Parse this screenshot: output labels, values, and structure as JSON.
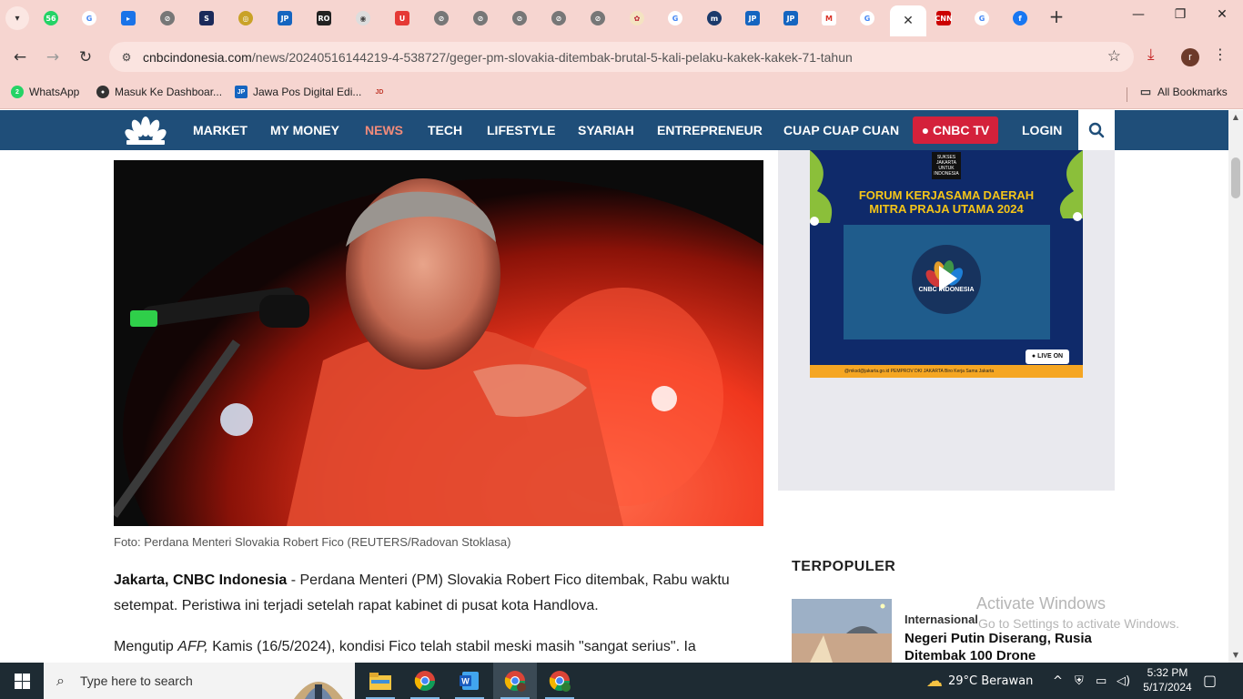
{
  "browser": {
    "active_tab_close": "✕",
    "new_tab": "+",
    "window_controls": {
      "minimize": "—",
      "maximize": "❐",
      "close": "✕"
    },
    "url_domain": "cnbcindonesia.com",
    "url_path": "/news/20240516144219-4-538727/geger-pm-slovakia-ditembak-brutal-5-kali-pelaku-kakek-kakek-71-tahun",
    "profile_initial": "r",
    "bookmarks": [
      {
        "label": "WhatsApp"
      },
      {
        "label": "Masuk Ke Dashboar..."
      },
      {
        "label": "Jawa Pos Digital Edi..."
      }
    ],
    "all_bookmarks": "All Bookmarks"
  },
  "site": {
    "nav": [
      {
        "label": "MARKET"
      },
      {
        "label": "MY MONEY"
      },
      {
        "label": "NEWS"
      },
      {
        "label": "TECH"
      },
      {
        "label": "LIFESTYLE"
      },
      {
        "label": "SYARIAH"
      },
      {
        "label": "ENTREPRENEUR"
      },
      {
        "label": "CUAP CUAP CUAN"
      }
    ],
    "cnbc_tv": "● CNBC TV",
    "login": "LOGIN"
  },
  "article": {
    "caption": "Foto: Perdana Menteri Slovakia Robert Fico (REUTERS/Radovan Stoklasa)",
    "lead_bold": "Jakarta, CNBC Indonesia",
    "lead_text": " - Perdana Menteri (PM) Slovakia Robert Fico ditembak, Rabu waktu setempat. Peristiwa ini terjadi setelah rapat kabinet di pusat kota Handlova.",
    "para2_a": "Mengutip ",
    "para2_italic": "AFP,",
    "para2_b": " Kamis (16/5/2024), kondisi Fico telah stabil meski masih \"sangat serius\". Ia"
  },
  "sidebar": {
    "ad": {
      "badge": "SUKSES JAKARTA UNTUK INDONESIA",
      "title_line1": "FORUM KERJASAMA DAERAH",
      "title_line2": "MITRA PRAJA UTAMA 2024",
      "video_logo": "CNBC INDONESIA",
      "live": "● LIVE ON",
      "footer": "@mksd@jakarta.go.id     PEMPROV DKI JAKARTA     Biro Kerja Sama Jakarta"
    },
    "popular_heading": "TERPOPULER",
    "popular": [
      {
        "category": "Internasional",
        "title": "Negeri Putin Diserang, Rusia Ditembak 100 Drone"
      }
    ]
  },
  "windows": {
    "activate_title": "Activate Windows",
    "activate_sub": "Go to Settings to activate Windows.",
    "search_placeholder": "Type here to search",
    "weather": "29°C  Berawan",
    "time": "5:32 PM",
    "date": "5/17/2024"
  },
  "colors": {
    "chrome_bg": "#f6d5d0",
    "site_nav": "#1f4e79",
    "nav_active": "#f28b7a",
    "cnbc_tv": "#d4213b",
    "taskbar": "#1e2b33"
  }
}
